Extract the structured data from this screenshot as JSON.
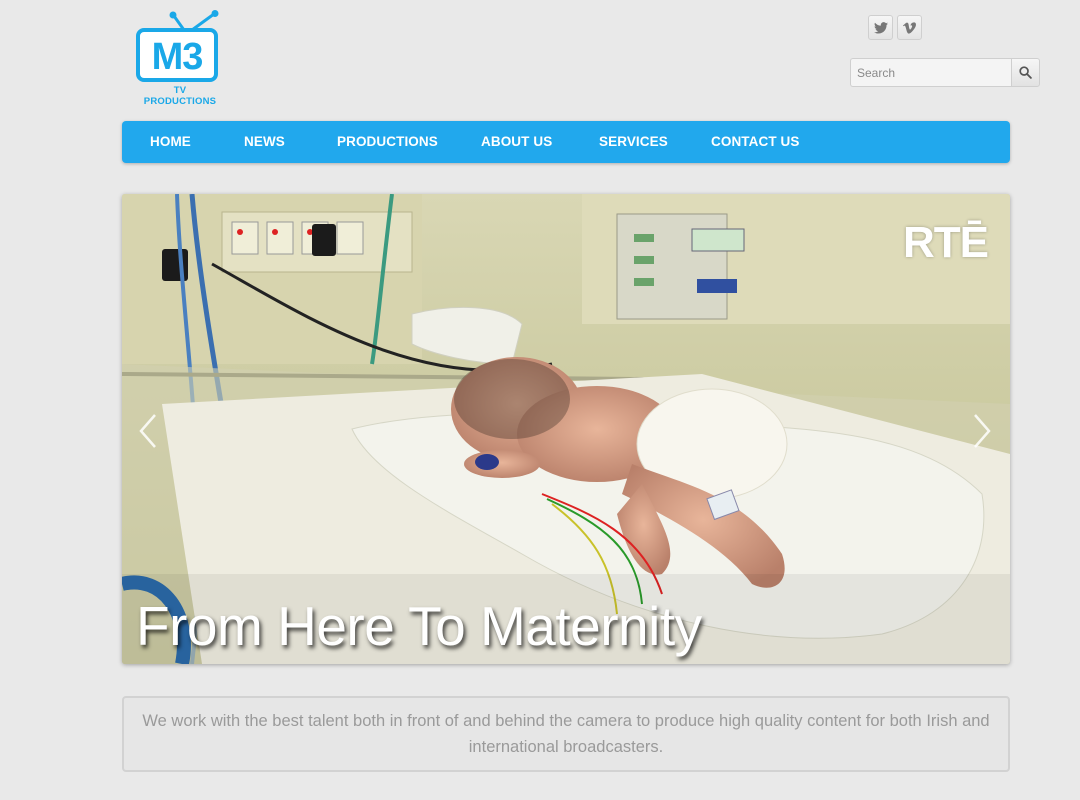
{
  "logo": {
    "text": "M3",
    "subtitle": "TV PRODUCTIONS"
  },
  "social": [
    {
      "name": "twitter",
      "glyph": "t"
    },
    {
      "name": "vimeo",
      "glyph": "v"
    }
  ],
  "search": {
    "placeholder": "Search"
  },
  "nav": {
    "items": [
      "HOME",
      "NEWS",
      "PRODUCTIONS",
      "ABOUT US",
      "SERVICES",
      "CONTACT US"
    ]
  },
  "slider": {
    "caption": "From Here To Maternity",
    "broadcaster": "RTĒ"
  },
  "intro": {
    "text": "We work with the best talent both in front of and behind the camera to produce high quality content for both Irish and international broadcasters."
  },
  "colors": {
    "accent": "#21a8ed",
    "logo": "#1aa8e8",
    "background": "#e9e9e9"
  }
}
